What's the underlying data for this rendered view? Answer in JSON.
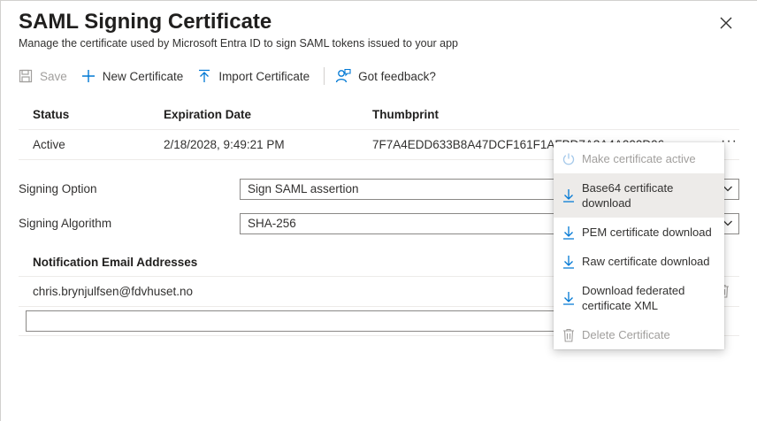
{
  "header": {
    "title": "SAML Signing Certificate",
    "subtitle": "Manage the certificate used by Microsoft Entra ID to sign SAML tokens issued to your app"
  },
  "toolbar": {
    "save": "Save",
    "new_certificate": "New Certificate",
    "import_certificate": "Import Certificate",
    "feedback": "Got feedback?"
  },
  "cert_table": {
    "headers": [
      "Status",
      "Expiration Date",
      "Thumbprint"
    ],
    "rows": [
      {
        "status": "Active",
        "expiration": "2/18/2028, 9:49:21 PM",
        "thumbprint": "7F7A4EDD633B8A47DCF161F1AFBD7A3A4A000D06"
      }
    ]
  },
  "signing": {
    "option_label": "Signing Option",
    "option_value": "Sign SAML assertion",
    "algorithm_label": "Signing Algorithm",
    "algorithm_value": "SHA-256"
  },
  "notification": {
    "header": "Notification Email Addresses",
    "emails": [
      "chris.brynjulfsen@fdvhuset.no"
    ],
    "input_value": ""
  },
  "context_menu": {
    "items": [
      {
        "label": "Make certificate active",
        "icon": "power-icon",
        "disabled": true
      },
      {
        "label": "Base64 certificate download",
        "icon": "download-icon",
        "disabled": false
      },
      {
        "label": "PEM certificate download",
        "icon": "download-icon",
        "disabled": false
      },
      {
        "label": "Raw certificate download",
        "icon": "download-icon",
        "disabled": false
      },
      {
        "label": "Download federated certificate XML",
        "icon": "download-icon",
        "disabled": false
      },
      {
        "label": "Delete Certificate",
        "icon": "trash-icon",
        "disabled": true
      }
    ]
  },
  "colors": {
    "accent": "#0078d4",
    "disabled": "#a19f9d",
    "text": "#323130"
  }
}
